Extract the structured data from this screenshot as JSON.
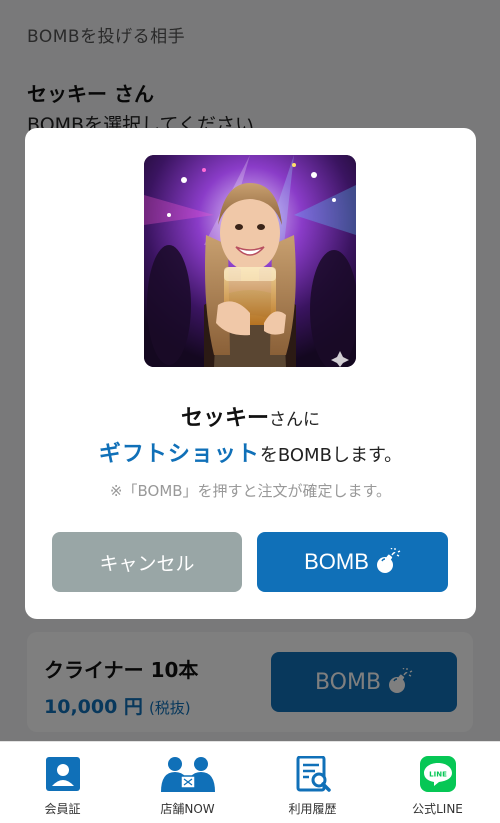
{
  "page": {
    "header": "BOMBを投げる相手",
    "target_name": "セッキー さん",
    "instruction": "BOMBを選択してください"
  },
  "product": {
    "name": "クライナー 10本",
    "price": "10,000 円",
    "tax_note": "(税抜)",
    "bomb_label": "BOMB"
  },
  "modal": {
    "recipient": "セッキー",
    "recipient_suffix": "さんに",
    "product": "ギフトショット",
    "product_suffix": "をBOMBします。",
    "note": "※「BOMB」を押すと注文が確定します。",
    "cancel_label": "キャンセル",
    "bomb_label": "BOMB"
  },
  "nav": {
    "items": [
      {
        "label": "会員証",
        "icon": "member-card-icon"
      },
      {
        "label": "店舗NOW",
        "icon": "store-now-icon"
      },
      {
        "label": "利用履歴",
        "icon": "history-icon"
      },
      {
        "label": "公式LINE",
        "icon": "line-icon"
      }
    ]
  },
  "colors": {
    "primary": "#1070b8",
    "cancel": "#99a6a6",
    "line_green": "#06c755"
  }
}
